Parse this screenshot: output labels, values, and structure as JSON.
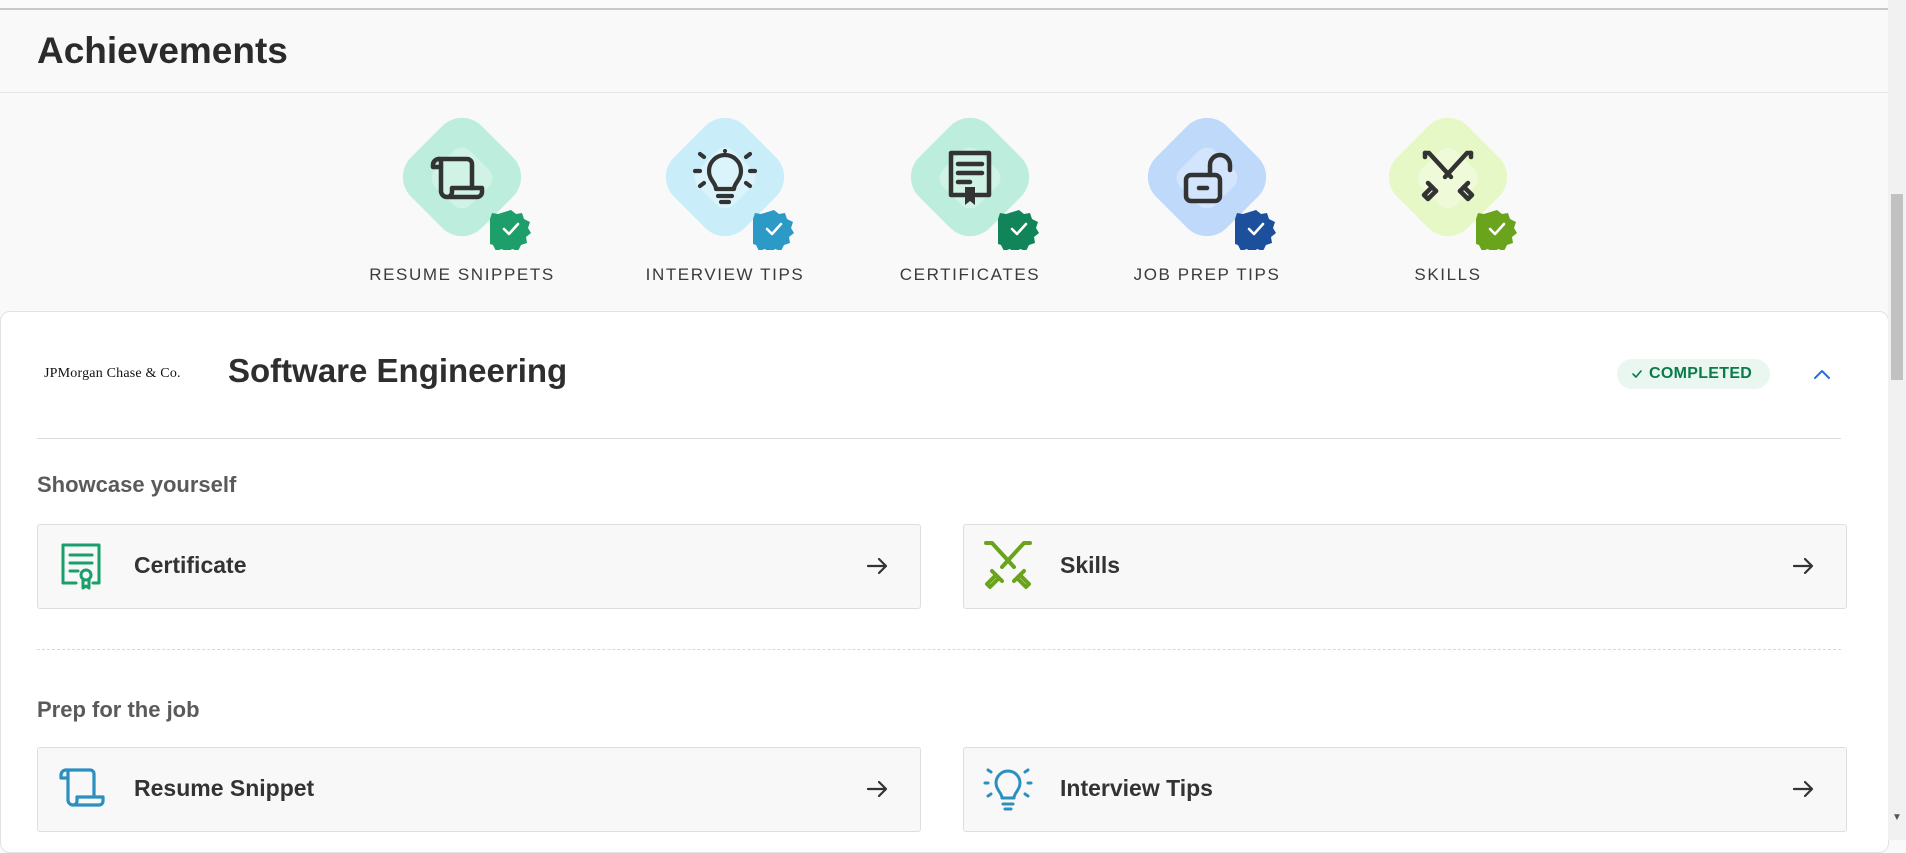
{
  "page": {
    "title": "Achievements"
  },
  "badges": [
    {
      "label": "RESUME SNIPPETS",
      "icon": "scroll-icon",
      "bg": "#bdeedd",
      "inner": "#d0f3e6",
      "seal": "#1e9e6a"
    },
    {
      "label": "INTERVIEW TIPS",
      "icon": "lightbulb-icon",
      "bg": "#c9eef9",
      "inner": "#dbf4fb",
      "seal": "#2b9ac6"
    },
    {
      "label": "CERTIFICATES",
      "icon": "certificate-icon",
      "bg": "#bdeedd",
      "inner": "#d0f3e6",
      "seal": "#12845a"
    },
    {
      "label": "JOB PREP TIPS",
      "icon": "unlock-icon",
      "bg": "#bfd9fb",
      "inner": "#d3e5fc",
      "seal": "#1c4f9c"
    },
    {
      "label": "SKILLS",
      "icon": "swords-icon",
      "bg": "#e6f8c6",
      "inner": "#eefad8",
      "seal": "#6aa31c"
    }
  ],
  "course": {
    "company_logo_text": "JPMorgan Chase & Co.",
    "title": "Software Engineering",
    "status": "COMPLETED",
    "status_color": "#0b7a4b"
  },
  "sections": [
    {
      "title": "Showcase yourself",
      "items": [
        {
          "label": "Certificate",
          "icon": "certificate-icon",
          "color": "#1a9e6a"
        },
        {
          "label": "Skills",
          "icon": "swords-icon",
          "color": "#6aa31c"
        }
      ]
    },
    {
      "title": "Prep for the job",
      "items": [
        {
          "label": "Resume Snippet",
          "icon": "scroll-icon",
          "color": "#2b8fc0"
        },
        {
          "label": "Interview Tips",
          "icon": "lightbulb-icon",
          "color": "#2b8fc0"
        }
      ]
    }
  ]
}
